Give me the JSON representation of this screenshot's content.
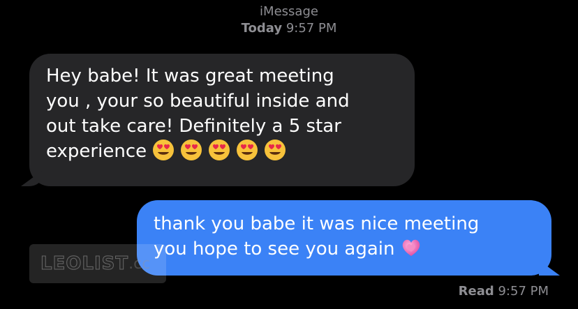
{
  "header": {
    "service": "iMessage",
    "day": "Today",
    "time": "9:57 PM"
  },
  "messages": [
    {
      "direction": "incoming",
      "text": "Hey babe! It was great meeting\nyou , your so beautiful inside and\nout take care! Definitely a 5 star\nexperience",
      "emoji": "smiling-face-with-heart-eyes",
      "emoji_count": 5
    },
    {
      "direction": "outgoing",
      "text": "thank you babe it was nice meeting\nyou hope to see you again",
      "emoji": "growing-heart"
    }
  ],
  "receipt": {
    "status": "Read",
    "time": "9:57 PM"
  },
  "watermark": {
    "text": "LEOLIST",
    "suffix": ".cc"
  },
  "colors": {
    "background": "#000000",
    "incoming_bubble": "#262628",
    "outgoing_bubble": "#3b82f6",
    "meta_text": "#8e8e93"
  }
}
